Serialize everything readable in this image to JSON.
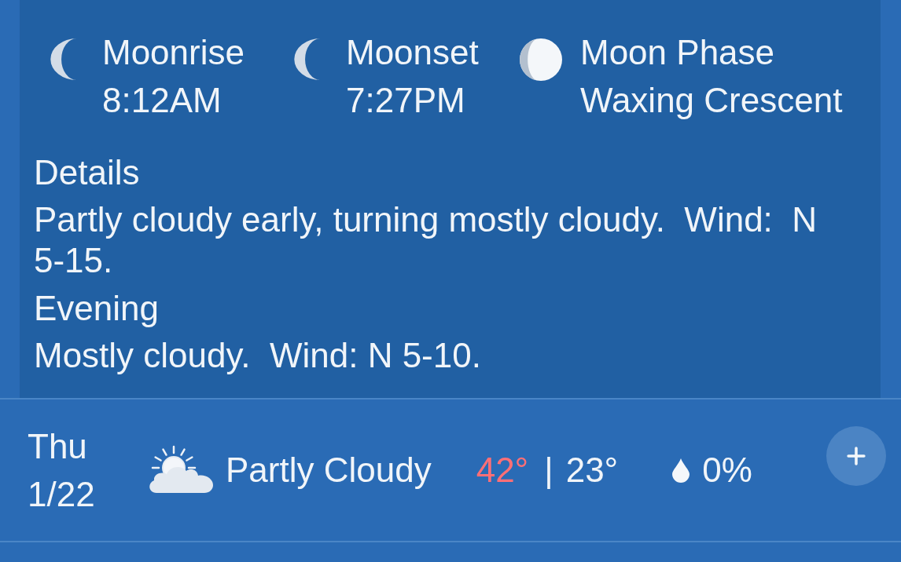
{
  "moon": [
    {
      "kind": "moonrise",
      "label": "Moonrise",
      "value": "8:12AM"
    },
    {
      "kind": "moonset",
      "label": "Moonset",
      "value": "7:27PM"
    },
    {
      "kind": "phase",
      "label": "Moon Phase",
      "value": "Waxing Crescent"
    }
  ],
  "details": [
    {
      "label": "Details",
      "text": "Partly cloudy early, turning mostly cloudy.  Wind:  N 5-15."
    },
    {
      "label": "Evening",
      "text": "Mostly cloudy.  Wind: N 5-10."
    }
  ],
  "forecast_row": {
    "day": "Thu",
    "date": "1/22",
    "condition": "Partly Cloudy",
    "high": "42°",
    "separator": "|",
    "low": "23°",
    "precipitation": "0%"
  }
}
